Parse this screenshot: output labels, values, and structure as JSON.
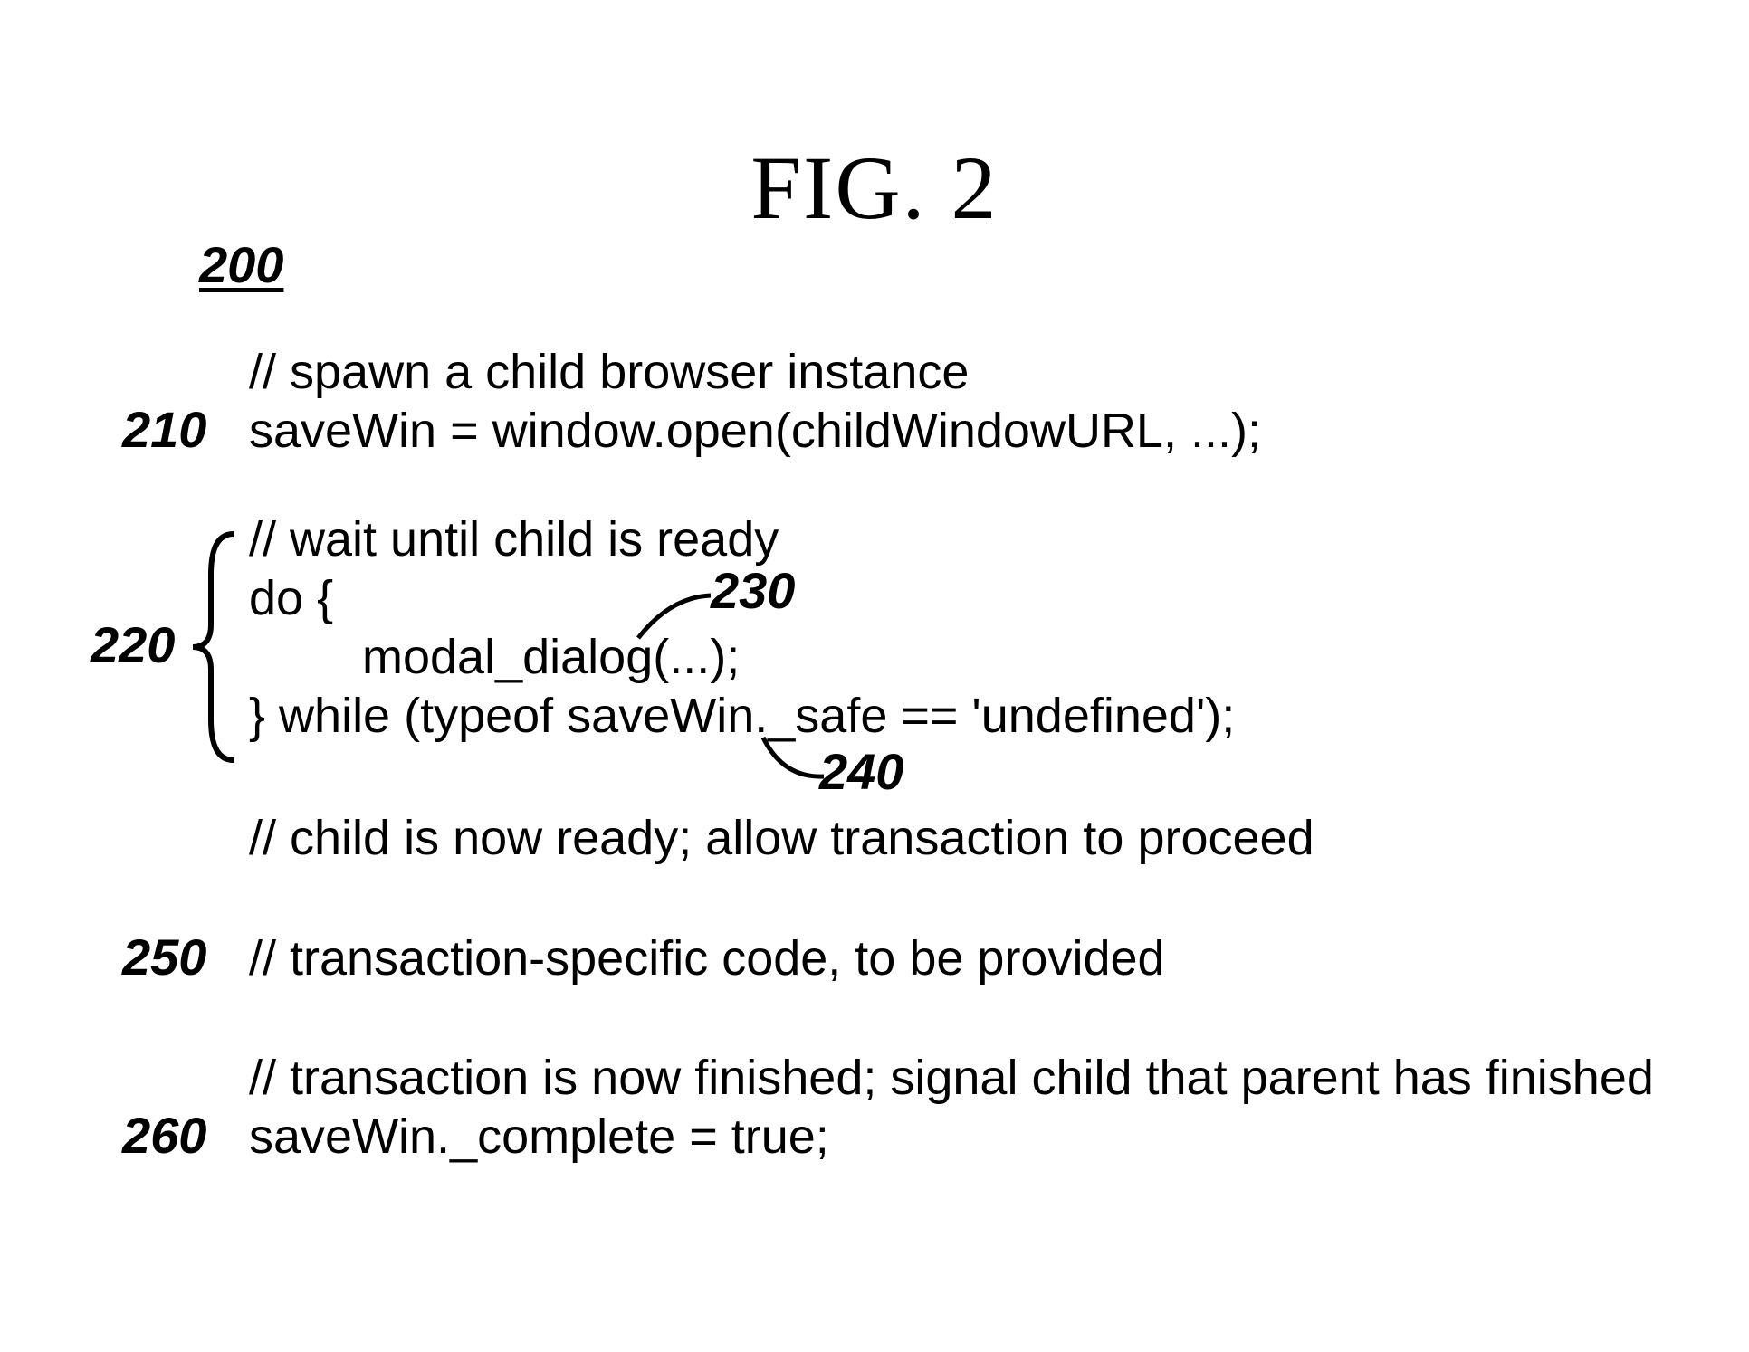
{
  "figure": {
    "title": "FIG. 2",
    "main_ref": "200"
  },
  "blocks": {
    "b210": {
      "ref": "210",
      "comment": "//  spawn a child browser instance",
      "code": "saveWin = window.open(childWindowURL, ...);"
    },
    "b220": {
      "ref": "220",
      "comment": "//  wait until child is ready",
      "do_open": "do {",
      "modal": "modal_dialog(...);",
      "close_while": "}     while (typeof saveWin._safe == 'undefined');",
      "ready_comment": "//  child is now ready; allow transaction to proceed"
    },
    "b230": {
      "ref": "230"
    },
    "b240": {
      "ref": "240"
    },
    "b250": {
      "ref": "250",
      "comment": "//  transaction-specific code, to be provided"
    },
    "b260": {
      "ref": "260",
      "comment": "//  transaction is now finished; signal child that parent has finished",
      "code": "saveWin._complete = true;"
    }
  }
}
